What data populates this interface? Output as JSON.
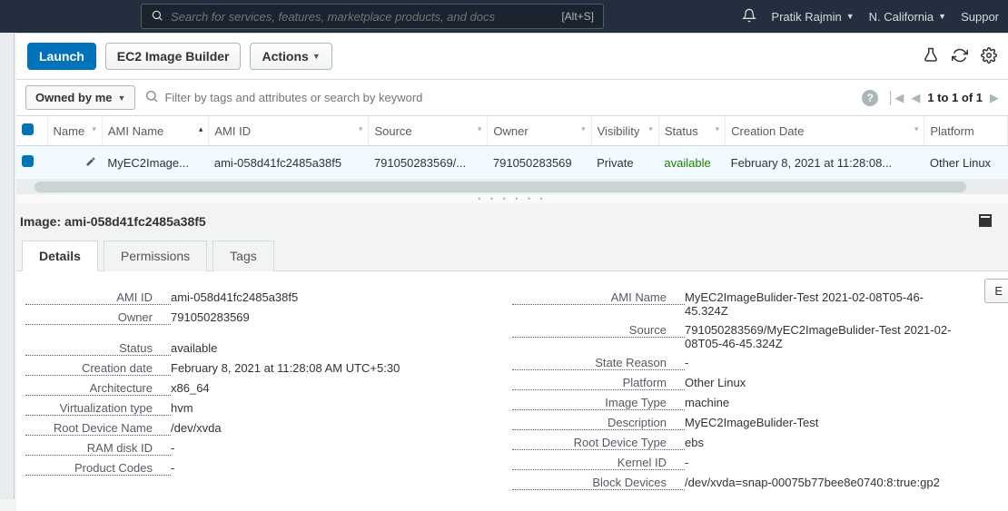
{
  "nav": {
    "search_placeholder": "Search for services, features, marketplace products, and docs",
    "search_shortcut": "[Alt+S]",
    "user": "Pratik Rajmin",
    "region": "N. California",
    "support": "Suppor"
  },
  "toolbar": {
    "launch": "Launch",
    "image_builder": "EC2 Image Builder",
    "actions": "Actions"
  },
  "filter": {
    "owned_label": "Owned by me",
    "placeholder": "Filter by tags and attributes or search by keyword",
    "pager_text": "1 to 1 of 1"
  },
  "table": {
    "headers": {
      "name": "Name",
      "ami_name": "AMI Name",
      "ami_id": "AMI ID",
      "source": "Source",
      "owner": "Owner",
      "visibility": "Visibility",
      "status": "Status",
      "creation": "Creation Date",
      "platform": "Platform"
    },
    "row": {
      "name": "",
      "ami_name": "MyEC2Image...",
      "ami_id": "ami-058d41fc2485a38f5",
      "source": "791050283569/...",
      "owner": "791050283569",
      "visibility": "Private",
      "status": "available",
      "creation": "February 8, 2021 at 11:28:08...",
      "platform": "Other Linux"
    }
  },
  "detail": {
    "heading": "Image: ami-058d41fc2485a38f5",
    "tabs": {
      "details": "Details",
      "permissions": "Permissions",
      "tags": "Tags"
    },
    "edit": "E",
    "left": {
      "ami_id_k": "AMI ID",
      "ami_id_v": "ami-058d41fc2485a38f5",
      "owner_k": "Owner",
      "owner_v": "791050283569",
      "status_k": "Status",
      "status_v": "available",
      "creation_k": "Creation date",
      "creation_v": "February 8, 2021 at 11:28:08 AM UTC+5:30",
      "arch_k": "Architecture",
      "arch_v": "x86_64",
      "virt_k": "Virtualization type",
      "virt_v": "hvm",
      "rootname_k": "Root Device Name",
      "rootname_v": "/dev/xvda",
      "ramdisk_k": "RAM disk ID",
      "ramdisk_v": "-",
      "product_k": "Product Codes",
      "product_v": "-"
    },
    "right": {
      "ami_name_k": "AMI Name",
      "ami_name_v": "MyEC2ImageBulider-Test 2021-02-08T05-46-45.324Z",
      "source_k": "Source",
      "source_v": "791050283569/MyEC2ImageBulider-Test 2021-02-08T05-46-45.324Z",
      "state_k": "State Reason",
      "state_v": "-",
      "platform_k": "Platform",
      "platform_v": "Other Linux",
      "imgtype_k": "Image Type",
      "imgtype_v": "machine",
      "desc_k": "Description",
      "desc_v": "MyEC2ImageBulider-Test",
      "roottype_k": "Root Device Type",
      "roottype_v": "ebs",
      "kernel_k": "Kernel ID",
      "kernel_v": "-",
      "block_k": "Block Devices",
      "block_v": "/dev/xvda=snap-00075b77bee8e0740:8:true:gp2"
    }
  }
}
